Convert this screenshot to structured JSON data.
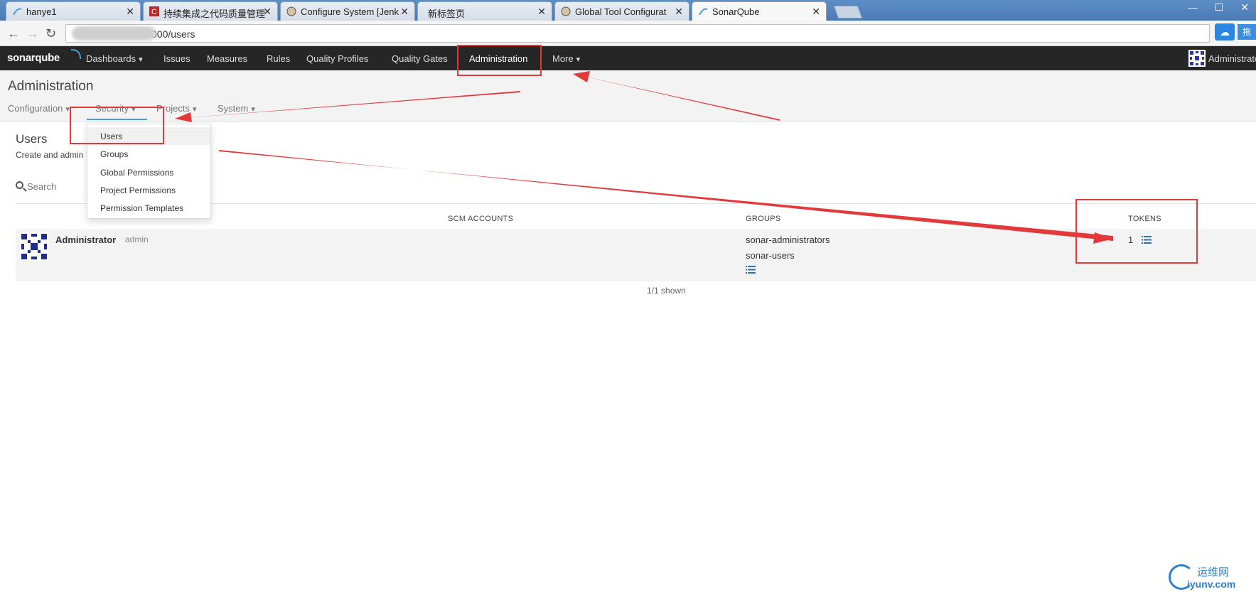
{
  "browser": {
    "tabs": [
      {
        "label": "hanye1"
      },
      {
        "label": "持续集成之代码质量管理"
      },
      {
        "label": "Configure System [Jenk"
      },
      {
        "label": "新标签页"
      },
      {
        "label": "Global Tool Configurat"
      },
      {
        "label": "SonarQube"
      }
    ],
    "url": "000/users",
    "ext_label": "拖"
  },
  "sonar_nav": {
    "logo": "sonarqube",
    "items": [
      {
        "label": "Dashboards",
        "dropdown": true
      },
      {
        "label": "Issues"
      },
      {
        "label": "Measures"
      },
      {
        "label": "Rules"
      },
      {
        "label": "Quality Profiles"
      },
      {
        "label": "Quality Gates"
      },
      {
        "label": "Administration"
      },
      {
        "label": "More",
        "dropdown": true
      }
    ],
    "user": "Administrator"
  },
  "admin": {
    "title": "Administration",
    "sub_nav": [
      {
        "label": "Configuration"
      },
      {
        "label": "Security"
      },
      {
        "label": "Projects"
      },
      {
        "label": "System"
      }
    ]
  },
  "security_menu": {
    "items": [
      {
        "label": "Users"
      },
      {
        "label": "Groups"
      },
      {
        "label": "Global Permissions"
      },
      {
        "label": "Project Permissions"
      },
      {
        "label": "Permission Templates"
      }
    ]
  },
  "users_page": {
    "title": "Users",
    "description": "Create and admin",
    "search_placeholder": "Search",
    "columns": {
      "scm": "SCM ACCOUNTS",
      "groups": "GROUPS",
      "tokens": "TOKENS"
    },
    "rows": [
      {
        "name": "Administrator",
        "login": "admin",
        "groups": [
          "sonar-administrators",
          "sonar-users"
        ],
        "tokens": "1"
      }
    ],
    "shown": "1/1 shown"
  },
  "watermark": {
    "cn": "运维网",
    "en": "iyunv.com"
  },
  "colors": {
    "annotation": "#e23a3a",
    "nav_bg": "#262626",
    "accent": "#4b9fd5"
  }
}
